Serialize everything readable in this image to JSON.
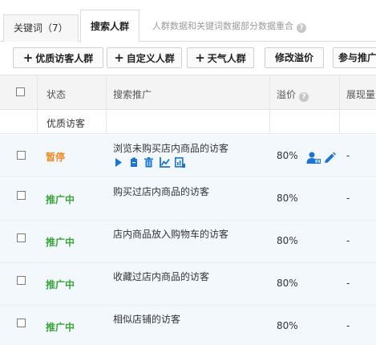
{
  "tabs": [
    {
      "label": "关键词（7）"
    },
    {
      "label": "搜索人群"
    }
  ],
  "tab_note": "人群数据和关键词数据部分数据重合",
  "toolbar": {
    "buttons": [
      {
        "label": "优质访客人群",
        "has_plus": true
      },
      {
        "label": "自定义人群",
        "has_plus": true
      },
      {
        "label": "天气人群",
        "has_plus": true
      },
      {
        "label": "修改溢价",
        "has_plus": false
      },
      {
        "label": "参与推广",
        "has_plus": false
      }
    ]
  },
  "table": {
    "headers": {
      "status": "状态",
      "promo": "搜索推广",
      "premium": "溢价",
      "impressions": "展现量"
    },
    "group_label": "优质访客",
    "rows": [
      {
        "status": "暂停",
        "status_kind": "pause",
        "name": "浏览未购买店内商品的访客",
        "premium": "80%",
        "impressions": "-"
      },
      {
        "status": "推广中",
        "status_kind": "on",
        "name": "购买过店内商品的访客",
        "premium": "80%",
        "impressions": "-"
      },
      {
        "status": "推广中",
        "status_kind": "on",
        "name": "店内商品放入购物车的访客",
        "premium": "80%",
        "impressions": "-"
      },
      {
        "status": "推广中",
        "status_kind": "on",
        "name": "收藏过店内商品的访客",
        "premium": "80%",
        "impressions": "-"
      },
      {
        "status": "推广中",
        "status_kind": "on",
        "name": "相似店铺的访客",
        "premium": "80%",
        "impressions": "-"
      }
    ]
  },
  "colors": {
    "accent": "#1b74d4",
    "pause": "#ef8a1f",
    "active": "#3aa43a"
  }
}
